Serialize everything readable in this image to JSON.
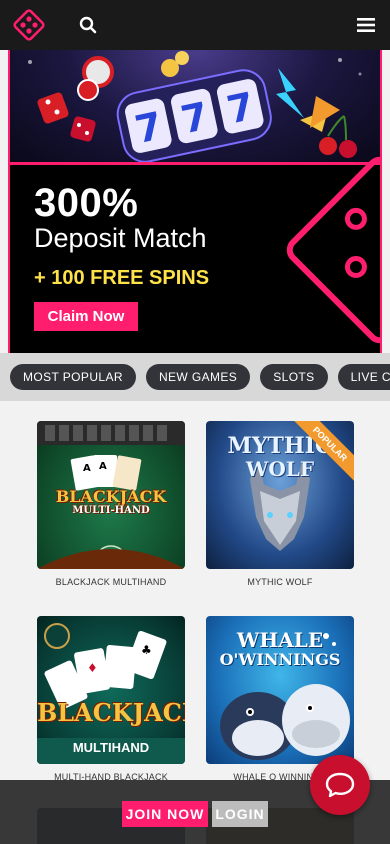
{
  "header": {
    "logo_icon": "dice-logo-icon",
    "search_icon": "search-icon",
    "menu_icon": "hamburger-menu-icon"
  },
  "hero": {
    "headline": "300%",
    "subheadline": "Deposit Match",
    "spins": "+ 100 FREE SPINS",
    "cta_label": "Claim Now",
    "accent_color": "#ff1e6e",
    "highlight_color": "#ffe24a"
  },
  "tabs": [
    {
      "label": "MOST POPULAR"
    },
    {
      "label": "NEW GAMES"
    },
    {
      "label": "SLOTS"
    },
    {
      "label": "LIVE CASINO"
    }
  ],
  "games": [
    {
      "name": "BLACKJACK MULTIHAND",
      "art_title": "BLACKJACK",
      "art_sub": "MULTI-HAND"
    },
    {
      "name": "MYTHIC WOLF",
      "art_title": "MYTHIC",
      "art_sub": "WOLF",
      "badge": "POPULAR"
    },
    {
      "name": "MULTI-HAND BLACKJACK",
      "art_title": "BLACKJACK",
      "art_sub": "MULTIHAND"
    },
    {
      "name": "WHALE O WINNINGS",
      "art_title": "WHALE",
      "art_sub": "O'WINNINGS"
    }
  ],
  "bottom_bar": {
    "join_label": "JOIN NOW",
    "login_label": "LOGIN",
    "chat_icon": "chat-bubble-icon"
  }
}
